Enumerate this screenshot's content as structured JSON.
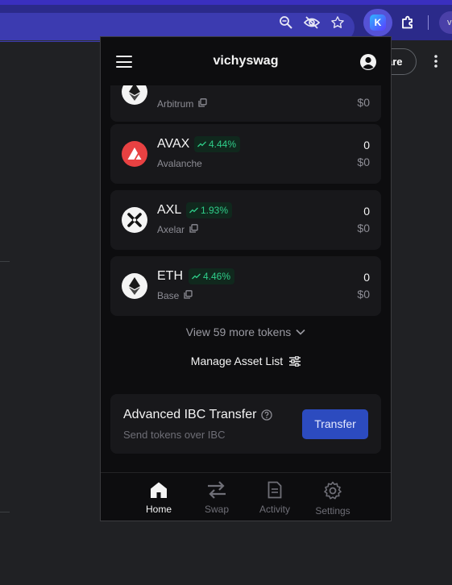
{
  "account": {
    "name": "vichyswag"
  },
  "background_page": {
    "share_label": "are",
    "profile_initial": "v"
  },
  "tokens": [
    {
      "symbol": "",
      "chain": "Arbitrum",
      "change": "",
      "amount": "",
      "value": "$0"
    },
    {
      "symbol": "AVAX",
      "chain": "Avalanche",
      "change": "4.44%",
      "amount": "0",
      "value": "$0"
    },
    {
      "symbol": "AXL",
      "chain": "Axelar",
      "change": "1.93%",
      "amount": "0",
      "value": "$0"
    },
    {
      "symbol": "ETH",
      "chain": "Base",
      "change": "4.46%",
      "amount": "0",
      "value": "$0"
    }
  ],
  "view_more": "View 59 more tokens",
  "manage_list": "Manage Asset List",
  "ibc": {
    "title": "Advanced IBC Transfer",
    "subtitle": "Send tokens over IBC",
    "button": "Transfer"
  },
  "nav": [
    {
      "label": "Home",
      "icon": "home-icon",
      "active": true
    },
    {
      "label": "Swap",
      "icon": "swap-icon",
      "active": false
    },
    {
      "label": "Activity",
      "icon": "activity-icon",
      "active": false
    },
    {
      "label": "Settings",
      "icon": "settings-icon",
      "active": false
    }
  ],
  "colors": {
    "accent": "#2c4bbf",
    "positive": "#2fce8a",
    "card": "#18181b",
    "background": "#0d0d0f"
  }
}
